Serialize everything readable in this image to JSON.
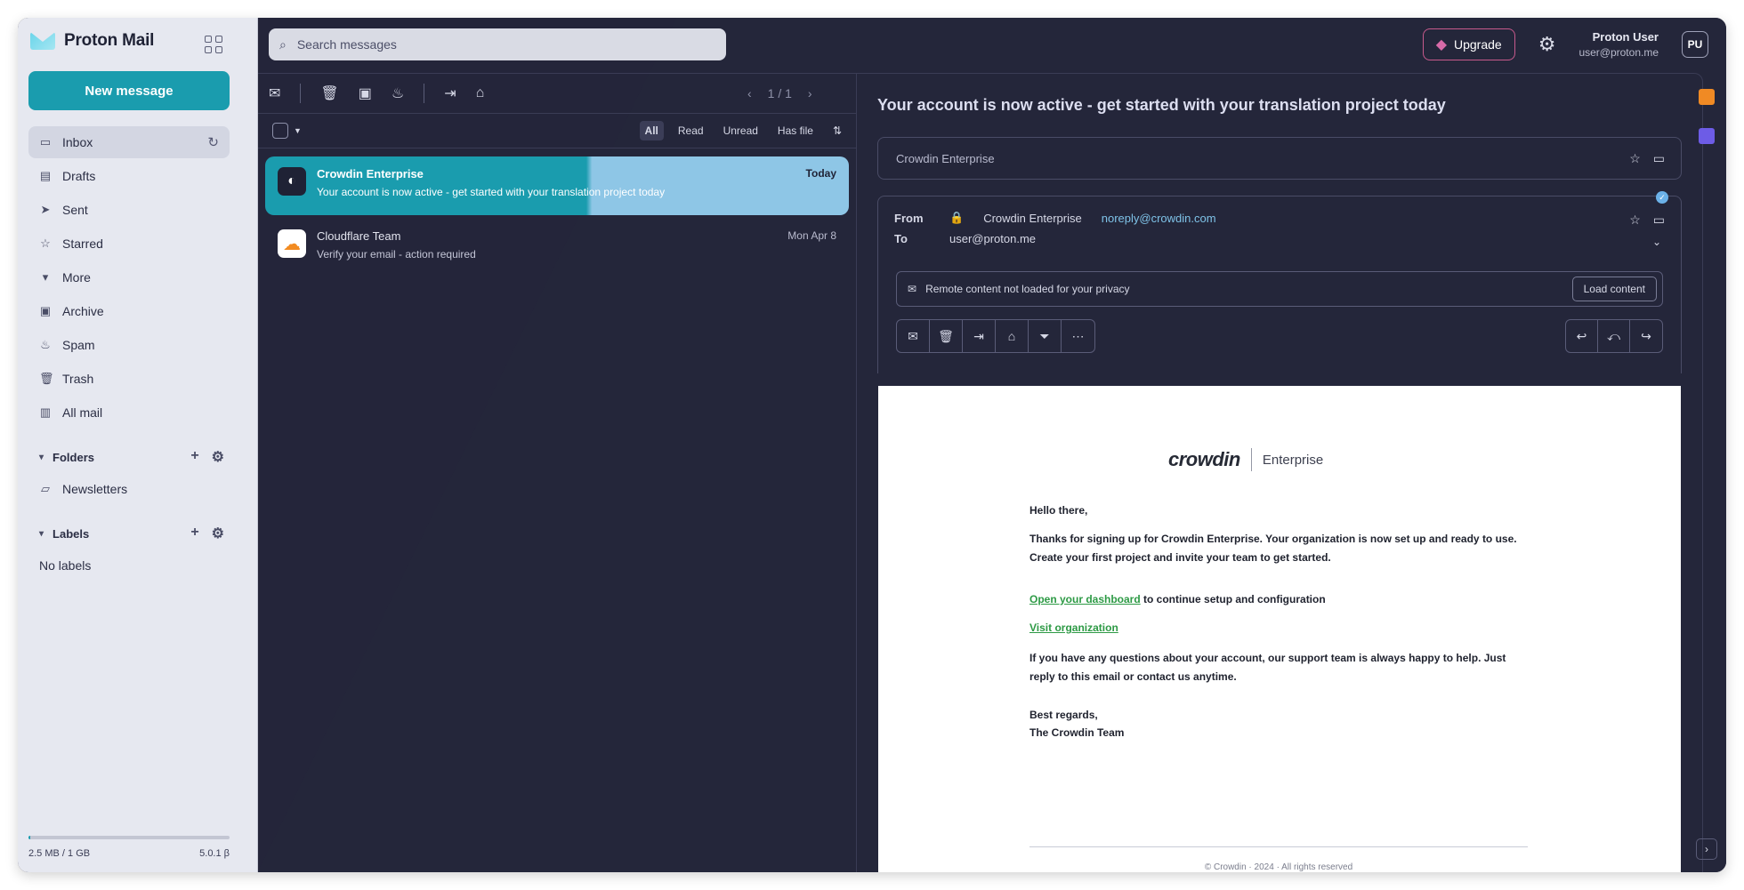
{
  "app": {
    "name": "Proton Mail"
  },
  "sidebar": {
    "new_message_label": "New message",
    "items": [
      {
        "label": "Inbox",
        "icon": "inbox-icon",
        "glyph": "▭"
      },
      {
        "label": "Drafts",
        "icon": "drafts-icon",
        "glyph": "▤"
      },
      {
        "label": "Sent",
        "icon": "sent-icon",
        "glyph": "➤"
      },
      {
        "label": "Starred",
        "icon": "star-icon",
        "glyph": "☆"
      },
      {
        "label": "More",
        "icon": "caret-icon",
        "glyph": "▾"
      },
      {
        "label": "Archive",
        "icon": "archive-icon",
        "glyph": "▣"
      },
      {
        "label": "Spam",
        "icon": "spam-icon",
        "glyph": "♨"
      },
      {
        "label": "Trash",
        "icon": "trash-icon",
        "glyph": "🗑"
      },
      {
        "label": "All mail",
        "icon": "allmail-icon",
        "glyph": "▥"
      }
    ],
    "folders_label": "Folders",
    "folder_items": [
      {
        "label": "Newsletters",
        "icon": "folder-icon"
      }
    ],
    "labels_label": "Labels",
    "label_items": [
      {
        "label": "No labels"
      }
    ],
    "storage_used": "2.5 MB / 1 GB",
    "storage_fraction": 0.005,
    "version": "5.0.1",
    "beta": "β"
  },
  "search": {
    "placeholder": "Search messages"
  },
  "topbar": {
    "upgrade_label": "Upgrade",
    "user_name": "Proton User",
    "user_email": "user@proton.me",
    "avatar_initials": "PU"
  },
  "list": {
    "pager": "1 / 1",
    "filters": [
      "All",
      "Read",
      "Unread",
      "Has file"
    ],
    "emails": [
      {
        "sender": "Crowdin Enterprise",
        "subject": "Your account is now active - get started with your translation project today",
        "time": "Today"
      },
      {
        "sender": "Cloudflare Team",
        "subject": "Verify your email - action required",
        "time": "Mon Apr 8"
      }
    ]
  },
  "reader": {
    "subject": "Your account is now active - get started with your translation project today",
    "collapsed_sender": "Crowdin Enterprise",
    "from_label": "From",
    "from_value": "Crowdin Enterprise",
    "from_email": "noreply@crowdin.com",
    "to_label": "To",
    "to_value": "user@proton.me",
    "banner_text": "Remote content not loaded for your privacy",
    "banner_button": "Load content",
    "verified": "✓"
  },
  "message": {
    "brand": "crowdin",
    "brand_sub": "Enterprise",
    "greeting": "Hello there,",
    "para1": "Thanks for signing up for Crowdin Enterprise. Your organization is now set up and ready to use. Create your first project and invite your team to get started.",
    "link1": "Open your dashboard",
    "link1_tail": " to continue setup and configuration",
    "link2": "Visit organization",
    "para2": "If you have any questions about your account, our support team is always happy to help. Just reply to this email or contact us anytime.",
    "sign1": "Best regards,",
    "sign2": "The Crowdin Team",
    "footer": "© Crowdin · 2024 · All rights reserved"
  }
}
